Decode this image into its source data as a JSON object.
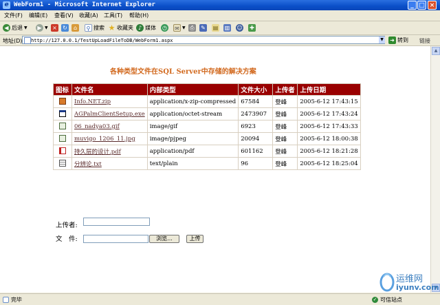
{
  "window": {
    "title": "WebForm1 - Microsoft Internet Explorer",
    "buttons": {
      "minimize": "_",
      "maximize": "□",
      "close": "×"
    }
  },
  "menu": [
    "文件(F)",
    "编辑(E)",
    "查看(V)",
    "收藏(A)",
    "工具(T)",
    "帮助(H)"
  ],
  "toolbar": {
    "back": "后退",
    "search": "搜索",
    "favorites": "收藏夹",
    "media": "媒体"
  },
  "address": {
    "label": "地址(D)",
    "url": "http://127.0.0.1/TestUpLoadFileToDB/WebForm1.aspx",
    "go": "转到",
    "links": "链接"
  },
  "page": {
    "heading": "各种类型文件在SQL Server中存储的解决方案",
    "table": {
      "headers": [
        "图标",
        "文件名",
        "内部类型",
        "文件大小",
        "上传者",
        "上传日期"
      ],
      "rows": [
        {
          "icon": "installer-icon",
          "name": "Info.NET.zip",
          "type": "application/x-zip-compressed",
          "size": "67584",
          "user": "登峰",
          "date": "2005-6-12 17:43:15"
        },
        {
          "icon": "window-icon",
          "name": "AGPalmClientSetup.exe",
          "type": "application/octet-stream",
          "size": "2473907",
          "user": "登峰",
          "date": "2005-6-12 17:43:24"
        },
        {
          "icon": "image-icon",
          "name": "06_nadya03.gif",
          "type": "image/gif",
          "size": "6923",
          "user": "登峰",
          "date": "2005-6-12 17:43:33"
        },
        {
          "icon": "image-icon",
          "name": "muvigo_1206_11.jpg",
          "type": "image/pjpeg",
          "size": "20094",
          "user": "登峰",
          "date": "2005-6-12 18:00:38"
        },
        {
          "icon": "pdf-icon",
          "name": "持久层的设计.pdf",
          "type": "application/pdf",
          "size": "601162",
          "user": "登峰",
          "date": "2005-6-12 18:21:28"
        },
        {
          "icon": "text-icon",
          "name": "分辨论.txt",
          "type": "text/plain",
          "size": "96",
          "user": "登峰",
          "date": "2005-6-12 18:25:04"
        }
      ]
    },
    "form": {
      "uploader_label": "上传者:",
      "uploader_value": "",
      "file_label": "文　件:",
      "file_value": "",
      "browse_button": "浏览...",
      "upload_button": "上传"
    }
  },
  "status": {
    "left": "完毕",
    "zone": "可信站点"
  },
  "watermark": {
    "name": "运维网",
    "url": "iyunv.com"
  },
  "colors": {
    "header_bg": "#990000",
    "heading": "#d2691e",
    "titlebar": "#0a4fc8"
  }
}
